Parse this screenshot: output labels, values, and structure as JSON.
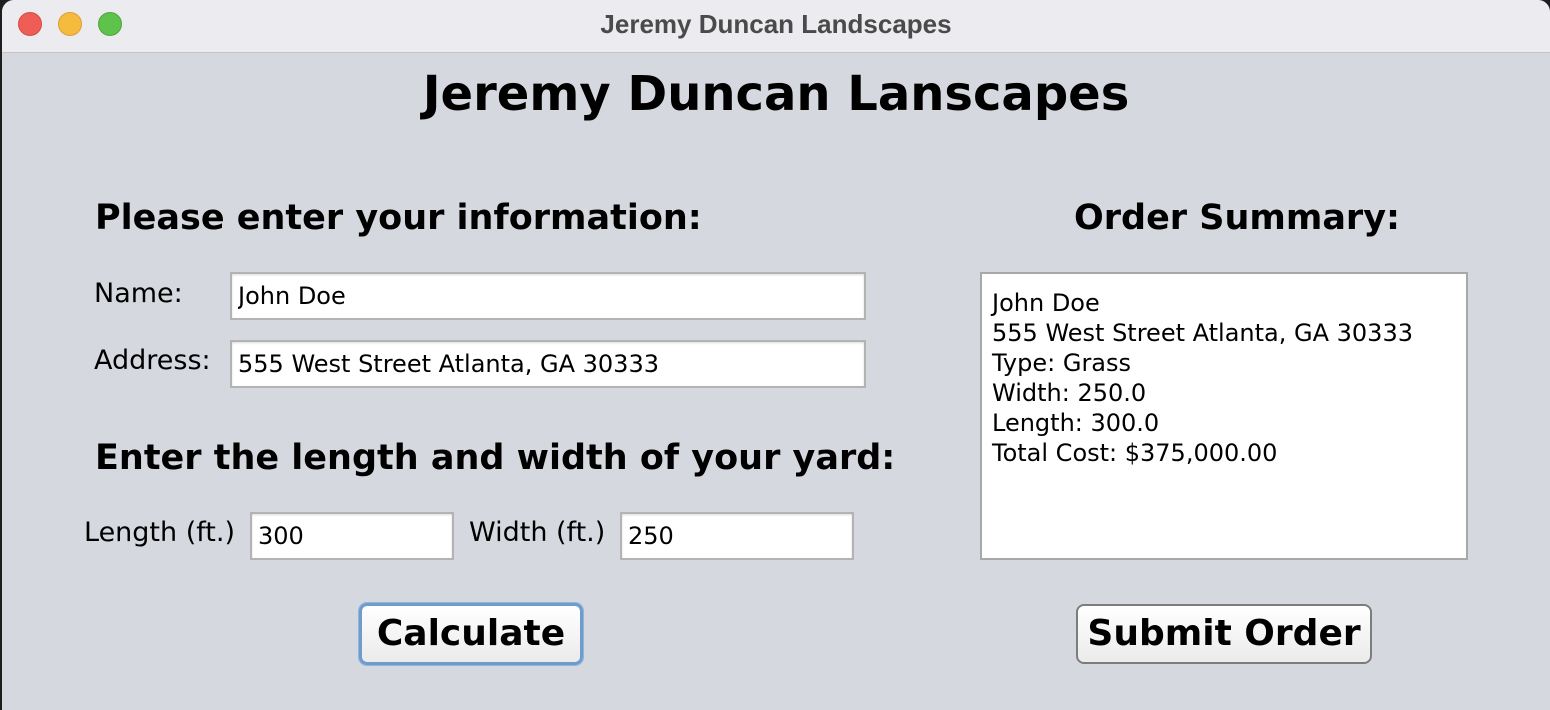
{
  "window": {
    "title": "Jeremy Duncan Landscapes"
  },
  "main": {
    "heading": "Jeremy Duncan Lanscapes"
  },
  "info_section": {
    "heading": "Please enter your information:",
    "name_label": "Name:",
    "name_value": "John Doe",
    "address_label": "Address:",
    "address_value": "555 West Street Atlanta, GA 30333"
  },
  "yard_section": {
    "heading": "Enter the length and width of your yard:",
    "length_label": "Length (ft.)",
    "length_value": "300",
    "width_label": "Width (ft.)",
    "width_value": "250"
  },
  "summary": {
    "heading": "Order Summary:",
    "lines": [
      "John Doe",
      "555 West Street Atlanta, GA 30333",
      "Type: Grass",
      "Width: 250.0",
      "Length: 300.0",
      "Total Cost: $375,000.00"
    ]
  },
  "buttons": {
    "calculate_label": "Calculate",
    "submit_label": "Submit Order"
  },
  "colors": {
    "window_bg": "#d5d8df",
    "titlebar_bg": "#ebebf0",
    "close": "#ee5e56",
    "minimize": "#f5bb3e",
    "maximize": "#5fc24b",
    "focus_ring": "#6f9ccb"
  },
  "icons": {
    "close": "close-icon",
    "minimize": "minimize-icon",
    "maximize": "maximize-icon"
  }
}
